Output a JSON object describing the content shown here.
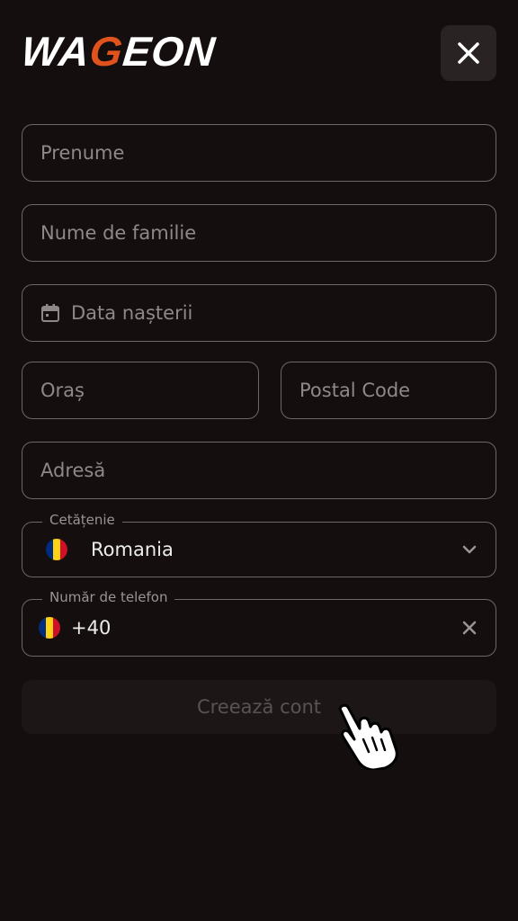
{
  "brand": {
    "logo_prefix": "WA",
    "logo_accent": "G",
    "logo_suffix": "EON"
  },
  "header": {
    "close_icon": "close-icon"
  },
  "form": {
    "first_name": {
      "placeholder": "Prenume"
    },
    "last_name": {
      "placeholder": "Nume de familie"
    },
    "birth_date": {
      "placeholder": "Data nașterii",
      "icon": "calendar-icon"
    },
    "city": {
      "placeholder": "Oraș"
    },
    "postal_code": {
      "placeholder": "Postal Code"
    },
    "address": {
      "placeholder": "Adresă"
    },
    "citizenship": {
      "label": "Cetățenie",
      "value": "Romania",
      "icon": "chevron-down-icon"
    },
    "phone": {
      "label": "Număr de telefon",
      "prefix": "+40",
      "icon": "clear-icon"
    },
    "submit_label": "Creează cont"
  },
  "colors": {
    "background": "#150e0e",
    "accent": "#e0531c",
    "border": "#6e6767",
    "flag_blue": "#002b7f",
    "flag_yellow": "#fcd116",
    "flag_red": "#ce1126"
  }
}
